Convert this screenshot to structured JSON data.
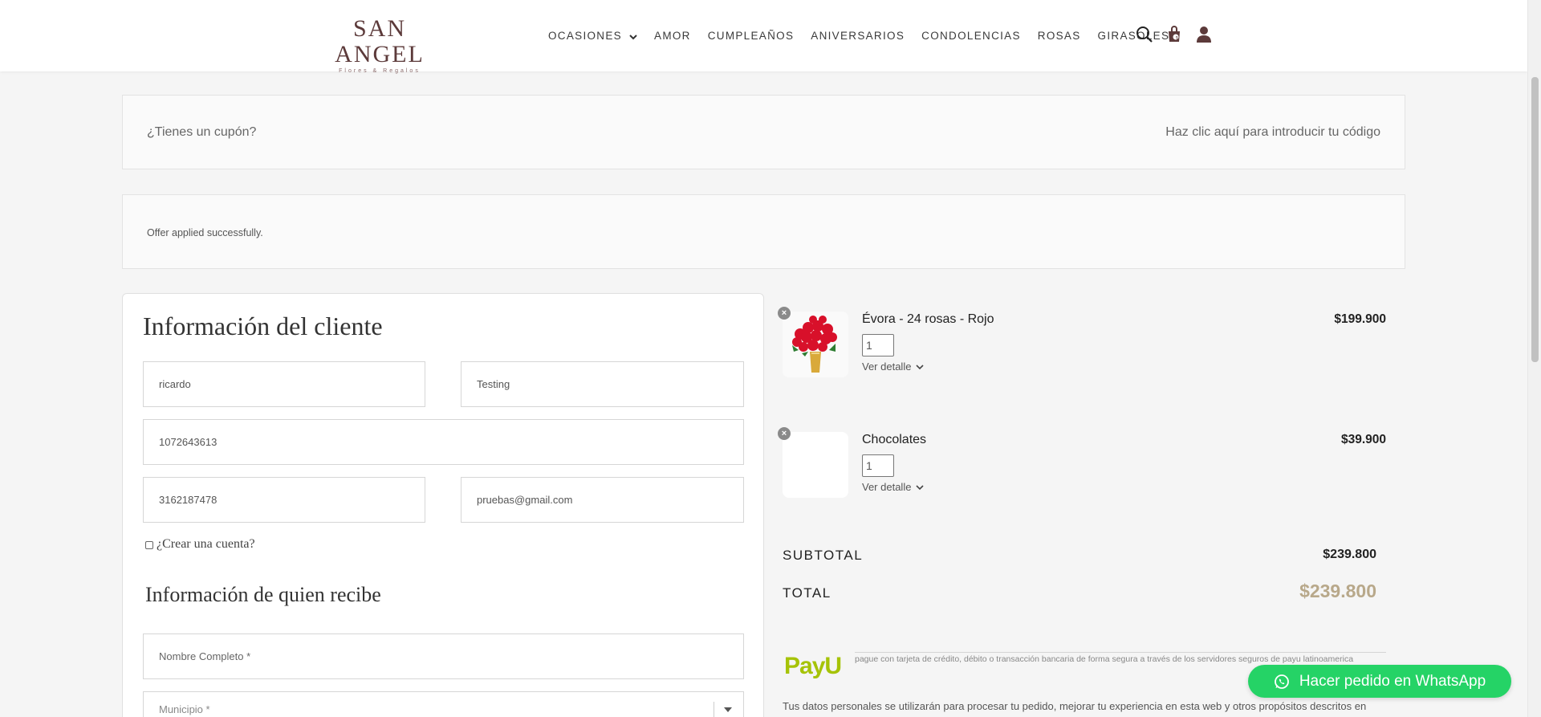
{
  "header": {
    "logo_main": "SAN ANGEL",
    "logo_sub": "Flores & Regalos",
    "nav": [
      {
        "label": "OCASIONES",
        "has_dropdown": true
      },
      {
        "label": "AMOR"
      },
      {
        "label": "CUMPLEAÑOS"
      },
      {
        "label": "ANIVERSARIOS"
      },
      {
        "label": "CONDOLENCIAS"
      },
      {
        "label": "ROSAS"
      },
      {
        "label": "GIRASOLES"
      }
    ],
    "icons": [
      "search-icon",
      "cart-icon",
      "user-icon"
    ],
    "cart_count": "1"
  },
  "coupon": {
    "question": "¿Tienes un cupón?",
    "link": "Haz clic aquí para introducir tu código"
  },
  "offer_notice": "Offer applied successfully.",
  "customer": {
    "title": "Información del cliente",
    "first_name": "ricardo",
    "last_name": "Testing",
    "document": "1072643613",
    "phone": "3162187478",
    "email": "pruebas@gmail.com",
    "create_account": "¿Crear una cuenta?"
  },
  "recipient": {
    "title": "Información de quien recibe",
    "name_placeholder": "Nombre Completo *",
    "municipio_placeholder": "Municipio *"
  },
  "cart": {
    "items": [
      {
        "name": "Évora - 24 rosas - Rojo",
        "qty": "1",
        "detail": "Ver detalle",
        "price": "$199.900"
      },
      {
        "name": "Chocolates",
        "qty": "1",
        "detail": "Ver detalle",
        "price": "$39.900"
      }
    ],
    "subtotal_label": "SUBTOTAL",
    "subtotal": "$239.800",
    "total_label": "TOTAL",
    "total": "$239.800"
  },
  "payment": {
    "provider": "PayU",
    "description": "pague con tarjeta de crédito, débito o transacción bancaria de forma segura a través de los servidores seguros de payu latinoamerica"
  },
  "privacy_text": "Tus datos personales se utilizarán para procesar tu pedido, mejorar tu experiencia en esta web y otros propósitos descritos en",
  "whatsapp": {
    "label": "Hacer pedido en WhatsApp"
  },
  "colors": {
    "brand": "#5c3a3a",
    "whatsapp": "#25d366",
    "total": "#b8a88a",
    "payu": "#a6c307"
  }
}
